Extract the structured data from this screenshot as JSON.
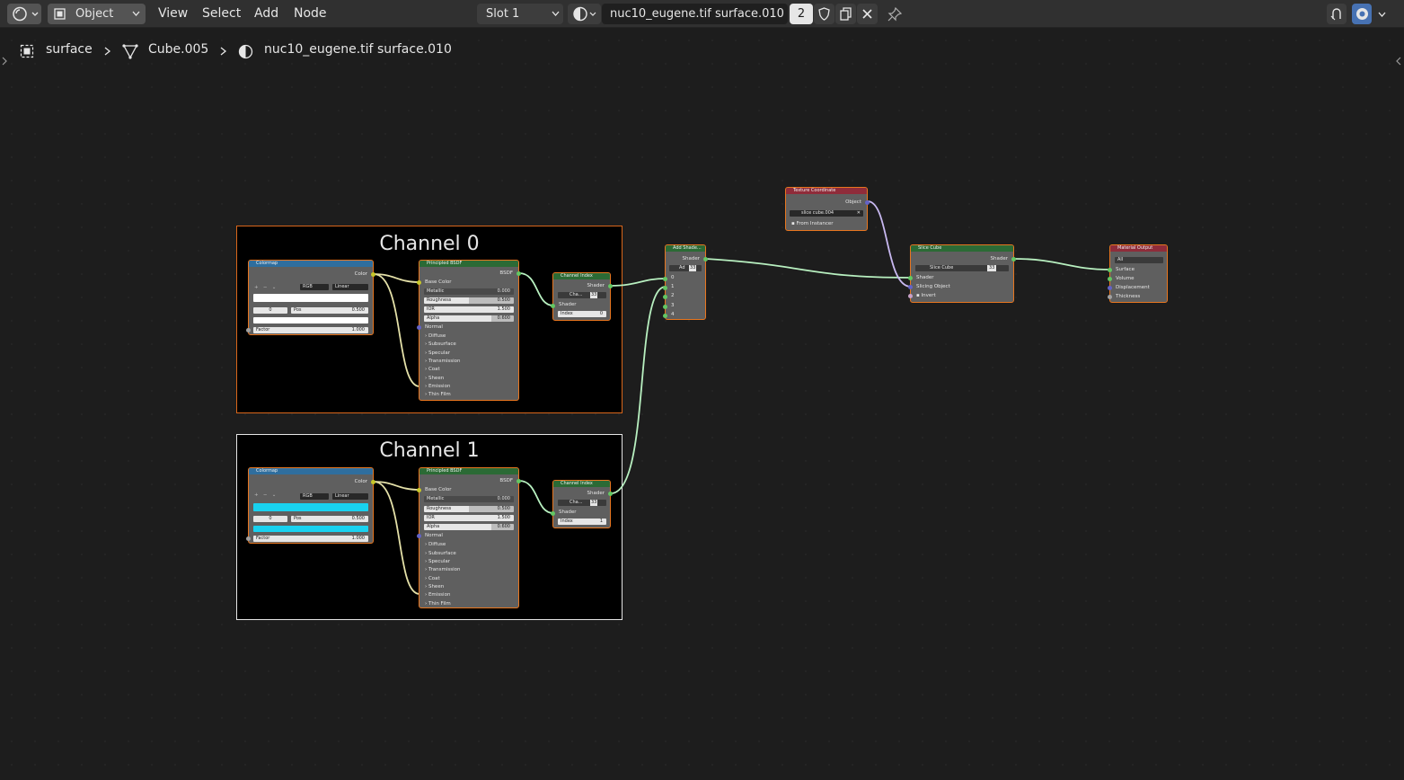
{
  "topbar": {
    "mode": "Object",
    "menus": [
      "View",
      "Select",
      "Add",
      "Node"
    ],
    "slot": "Slot 1",
    "material_name": "nuc10_eugene.tif surface.010",
    "user_count": "2"
  },
  "breadcrumb": {
    "object": "surface",
    "mesh": "Cube.005",
    "material": "nuc10_eugene.tif surface.010"
  },
  "frames": [
    {
      "title": "Channel 0"
    },
    {
      "title": "Channel 1"
    }
  ],
  "colormap": {
    "title": "Colormap",
    "output": "Color",
    "mode": "RGB",
    "interp": "Linear",
    "pos_index": "0",
    "pos_label": "Pos",
    "pos_value": "0.500",
    "factor_label": "Factor",
    "factor_value": "1.000",
    "ramp_colors": [
      "#ffffff",
      "#19d2f0"
    ]
  },
  "bsdf": {
    "title": "Principled BSDF",
    "output": "BSDF",
    "base_color": "Base Color",
    "metallic_label": "Metallic",
    "metallic": "0.000",
    "roughness_label": "Roughness",
    "roughness": "0.500",
    "ior_label": "IOR",
    "ior": "1.500",
    "alpha_label": "Alpha",
    "alpha": "0.600",
    "normal": "Normal",
    "panels": [
      "Diffuse",
      "Subsurface",
      "Specular",
      "Transmission",
      "Coat",
      "Sheen",
      "Emission",
      "Thin Film"
    ]
  },
  "channel_index": {
    "title": "Channel Index",
    "output": "Shader",
    "sub_label": "Cha...",
    "sub_count": "33",
    "input": "Shader",
    "index_label": "Index",
    "index_values": [
      "0",
      "1"
    ]
  },
  "add_shader": {
    "title": "Add Shade...",
    "output": "Shader",
    "sub_label": "Ad",
    "sub_count": "33",
    "inputs": [
      "0",
      "1",
      "2",
      "3",
      "4"
    ]
  },
  "tex_coord": {
    "title": "Texture Coordinate",
    "output": "Object",
    "object_name": "slice cube.004",
    "from_instancer": "From Instancer"
  },
  "slice_cube": {
    "title": "Slice Cube",
    "output": "Shader",
    "sub_label": "Slice Cube",
    "sub_count": "33",
    "input_shader": "Shader",
    "input_object": "Slicing Object",
    "invert": "Invert"
  },
  "material_output": {
    "title": "Material Output",
    "target": "All",
    "inputs": [
      "Surface",
      "Volume",
      "Displacement",
      "Thickness"
    ]
  },
  "colors": {
    "header_blue": "#2f6e9e",
    "header_green": "#2b6a35",
    "header_red": "#8f2c3a",
    "node_border": "#e8761f",
    "socket_yellow": "#c7c729",
    "socket_green": "#63c763",
    "socket_purple": "#6363c7",
    "socket_gray": "#a1a1a1",
    "wire_yellow": "#e4e0a8",
    "wire_green": "#b8f0c0"
  }
}
